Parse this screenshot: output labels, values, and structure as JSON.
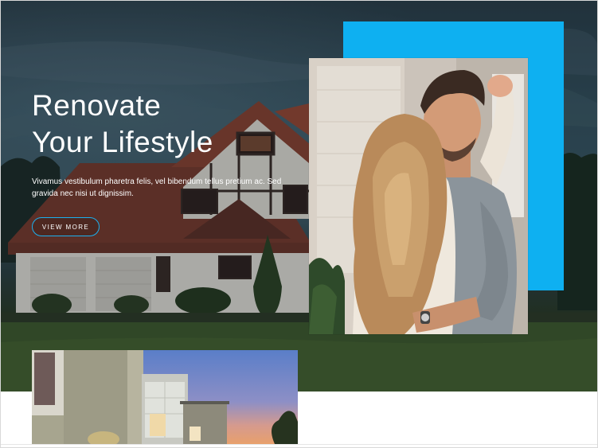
{
  "hero": {
    "title_line1": "Renovate",
    "title_line2": "Your Lifestyle",
    "description": "Vivamus vestibulum pharetra felis, vel bibendum tellus pretium ac. Sed gravida nec nisi ut dignissim.",
    "cta_label": "VIEW MORE",
    "background_image": "house-at-dusk-photo"
  },
  "feature_image": {
    "subject": "couple-embracing-photo"
  },
  "secondary_image": {
    "subject": "modern-building-at-sunset-photo"
  },
  "colors": {
    "accent": "#0eb0f1",
    "button_border": "#1bb1f0",
    "text": "#ffffff",
    "page_background": "#ffffff"
  }
}
